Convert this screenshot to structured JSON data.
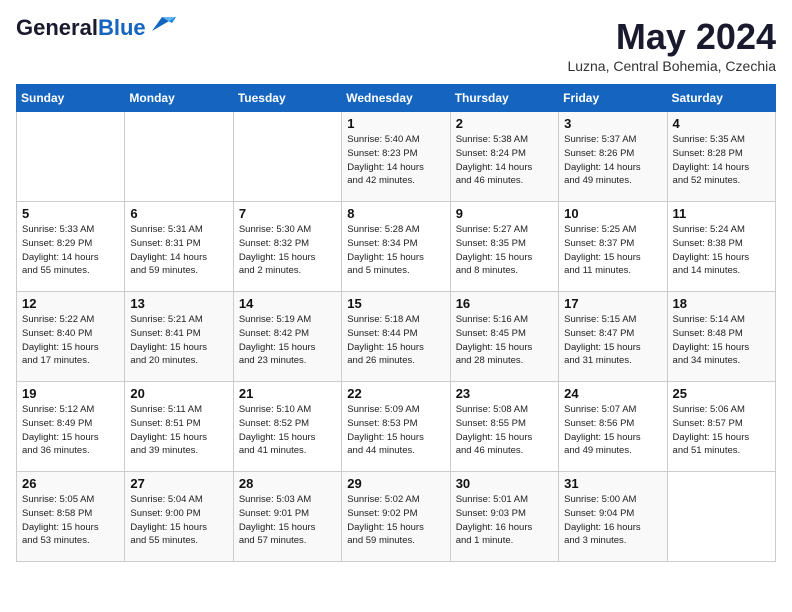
{
  "header": {
    "logo_general": "General",
    "logo_blue": "Blue",
    "month": "May 2024",
    "location": "Luzna, Central Bohemia, Czechia"
  },
  "days_of_week": [
    "Sunday",
    "Monday",
    "Tuesday",
    "Wednesday",
    "Thursday",
    "Friday",
    "Saturday"
  ],
  "weeks": [
    [
      {
        "day": "",
        "info": ""
      },
      {
        "day": "",
        "info": ""
      },
      {
        "day": "",
        "info": ""
      },
      {
        "day": "1",
        "info": "Sunrise: 5:40 AM\nSunset: 8:23 PM\nDaylight: 14 hours\nand 42 minutes."
      },
      {
        "day": "2",
        "info": "Sunrise: 5:38 AM\nSunset: 8:24 PM\nDaylight: 14 hours\nand 46 minutes."
      },
      {
        "day": "3",
        "info": "Sunrise: 5:37 AM\nSunset: 8:26 PM\nDaylight: 14 hours\nand 49 minutes."
      },
      {
        "day": "4",
        "info": "Sunrise: 5:35 AM\nSunset: 8:28 PM\nDaylight: 14 hours\nand 52 minutes."
      }
    ],
    [
      {
        "day": "5",
        "info": "Sunrise: 5:33 AM\nSunset: 8:29 PM\nDaylight: 14 hours\nand 55 minutes."
      },
      {
        "day": "6",
        "info": "Sunrise: 5:31 AM\nSunset: 8:31 PM\nDaylight: 14 hours\nand 59 minutes."
      },
      {
        "day": "7",
        "info": "Sunrise: 5:30 AM\nSunset: 8:32 PM\nDaylight: 15 hours\nand 2 minutes."
      },
      {
        "day": "8",
        "info": "Sunrise: 5:28 AM\nSunset: 8:34 PM\nDaylight: 15 hours\nand 5 minutes."
      },
      {
        "day": "9",
        "info": "Sunrise: 5:27 AM\nSunset: 8:35 PM\nDaylight: 15 hours\nand 8 minutes."
      },
      {
        "day": "10",
        "info": "Sunrise: 5:25 AM\nSunset: 8:37 PM\nDaylight: 15 hours\nand 11 minutes."
      },
      {
        "day": "11",
        "info": "Sunrise: 5:24 AM\nSunset: 8:38 PM\nDaylight: 15 hours\nand 14 minutes."
      }
    ],
    [
      {
        "day": "12",
        "info": "Sunrise: 5:22 AM\nSunset: 8:40 PM\nDaylight: 15 hours\nand 17 minutes."
      },
      {
        "day": "13",
        "info": "Sunrise: 5:21 AM\nSunset: 8:41 PM\nDaylight: 15 hours\nand 20 minutes."
      },
      {
        "day": "14",
        "info": "Sunrise: 5:19 AM\nSunset: 8:42 PM\nDaylight: 15 hours\nand 23 minutes."
      },
      {
        "day": "15",
        "info": "Sunrise: 5:18 AM\nSunset: 8:44 PM\nDaylight: 15 hours\nand 26 minutes."
      },
      {
        "day": "16",
        "info": "Sunrise: 5:16 AM\nSunset: 8:45 PM\nDaylight: 15 hours\nand 28 minutes."
      },
      {
        "day": "17",
        "info": "Sunrise: 5:15 AM\nSunset: 8:47 PM\nDaylight: 15 hours\nand 31 minutes."
      },
      {
        "day": "18",
        "info": "Sunrise: 5:14 AM\nSunset: 8:48 PM\nDaylight: 15 hours\nand 34 minutes."
      }
    ],
    [
      {
        "day": "19",
        "info": "Sunrise: 5:12 AM\nSunset: 8:49 PM\nDaylight: 15 hours\nand 36 minutes."
      },
      {
        "day": "20",
        "info": "Sunrise: 5:11 AM\nSunset: 8:51 PM\nDaylight: 15 hours\nand 39 minutes."
      },
      {
        "day": "21",
        "info": "Sunrise: 5:10 AM\nSunset: 8:52 PM\nDaylight: 15 hours\nand 41 minutes."
      },
      {
        "day": "22",
        "info": "Sunrise: 5:09 AM\nSunset: 8:53 PM\nDaylight: 15 hours\nand 44 minutes."
      },
      {
        "day": "23",
        "info": "Sunrise: 5:08 AM\nSunset: 8:55 PM\nDaylight: 15 hours\nand 46 minutes."
      },
      {
        "day": "24",
        "info": "Sunrise: 5:07 AM\nSunset: 8:56 PM\nDaylight: 15 hours\nand 49 minutes."
      },
      {
        "day": "25",
        "info": "Sunrise: 5:06 AM\nSunset: 8:57 PM\nDaylight: 15 hours\nand 51 minutes."
      }
    ],
    [
      {
        "day": "26",
        "info": "Sunrise: 5:05 AM\nSunset: 8:58 PM\nDaylight: 15 hours\nand 53 minutes."
      },
      {
        "day": "27",
        "info": "Sunrise: 5:04 AM\nSunset: 9:00 PM\nDaylight: 15 hours\nand 55 minutes."
      },
      {
        "day": "28",
        "info": "Sunrise: 5:03 AM\nSunset: 9:01 PM\nDaylight: 15 hours\nand 57 minutes."
      },
      {
        "day": "29",
        "info": "Sunrise: 5:02 AM\nSunset: 9:02 PM\nDaylight: 15 hours\nand 59 minutes."
      },
      {
        "day": "30",
        "info": "Sunrise: 5:01 AM\nSunset: 9:03 PM\nDaylight: 16 hours\nand 1 minute."
      },
      {
        "day": "31",
        "info": "Sunrise: 5:00 AM\nSunset: 9:04 PM\nDaylight: 16 hours\nand 3 minutes."
      },
      {
        "day": "",
        "info": ""
      }
    ]
  ]
}
